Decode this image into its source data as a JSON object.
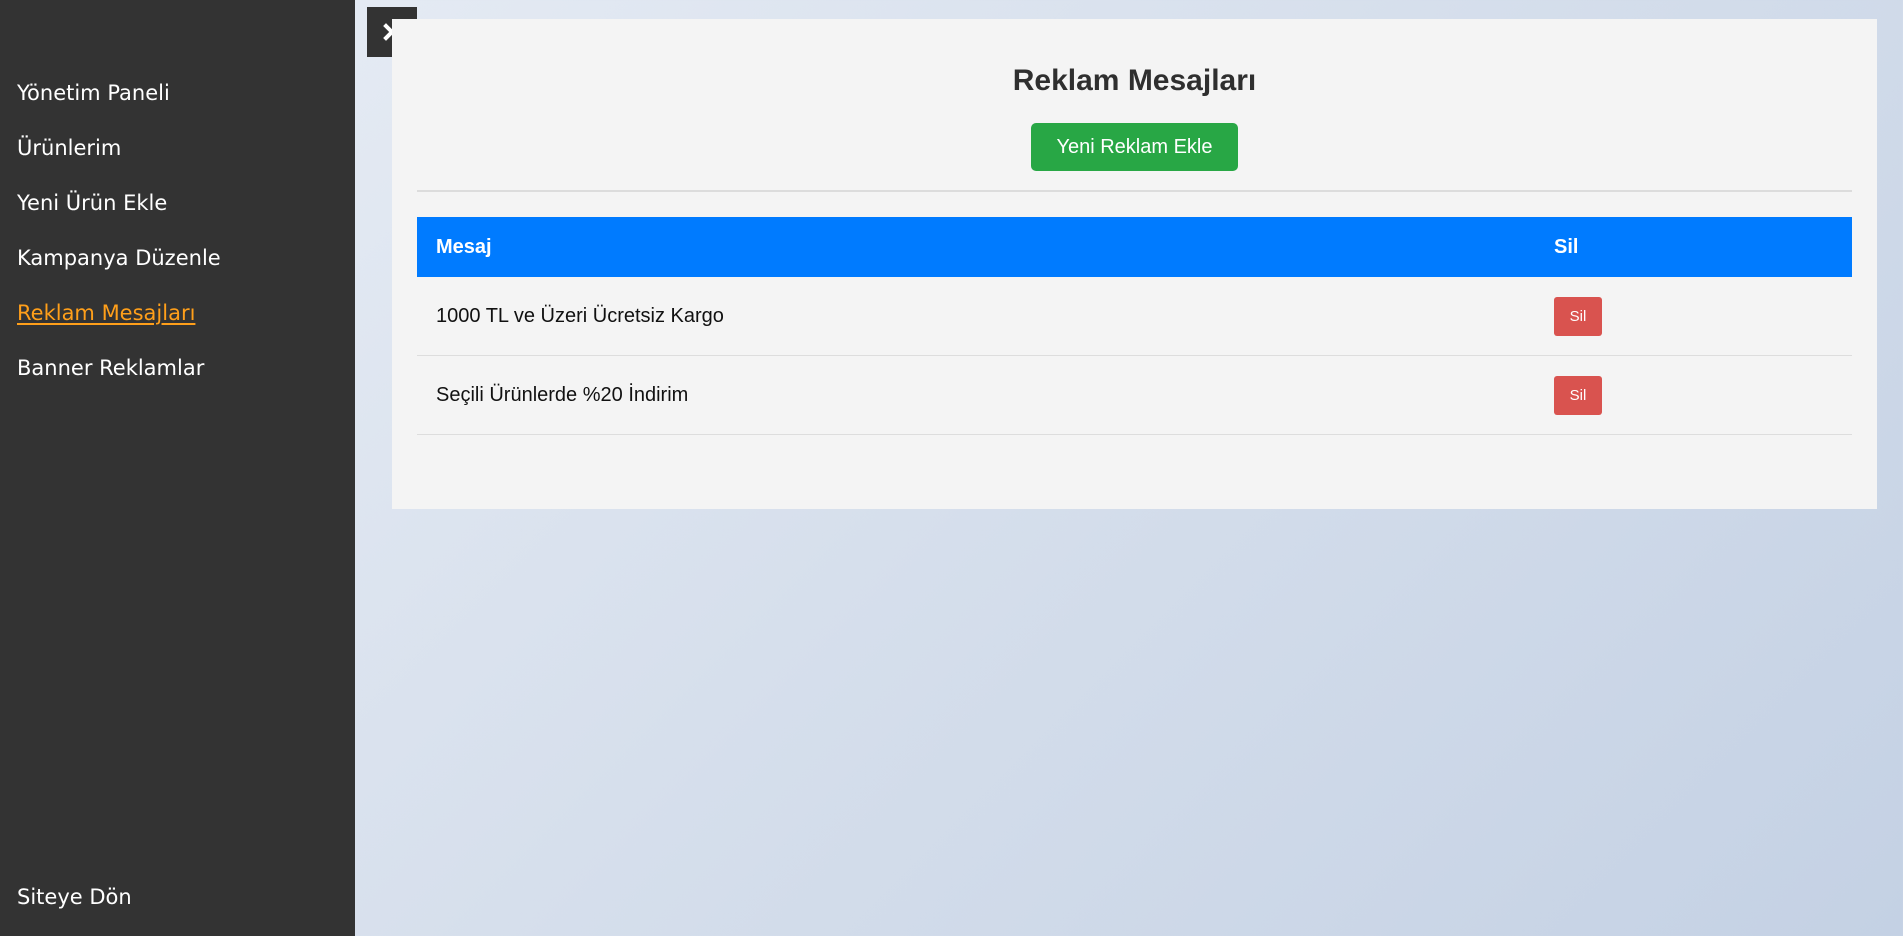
{
  "sidebar": {
    "items": [
      {
        "label": "Yönetim Paneli"
      },
      {
        "label": "Ürünlerim"
      },
      {
        "label": "Yeni Ürün Ekle"
      },
      {
        "label": "Kampanya Düzenle"
      },
      {
        "label": "Reklam Mesajları",
        "active": true
      },
      {
        "label": "Banner Reklamlar"
      }
    ],
    "footer_label": "Siteye Dön",
    "active_color": "#ff9f1a",
    "background_color": "#333333"
  },
  "close_button": {
    "icon": "close-icon"
  },
  "main": {
    "title": "Reklam Mesajları",
    "add_button_label": "Yeni Reklam Ekle",
    "table": {
      "headers": [
        "Mesaj",
        "Sil"
      ],
      "rows": [
        {
          "message": "1000 TL ve Üzeri Ücretsiz Kargo",
          "delete_label": "Sil"
        },
        {
          "message": "Seçili Ürünlerde %20 İndirim",
          "delete_label": "Sil"
        }
      ]
    },
    "colors": {
      "header_bg": "#007bff",
      "add_button": "#28a745",
      "delete_button": "#d9534f"
    }
  }
}
